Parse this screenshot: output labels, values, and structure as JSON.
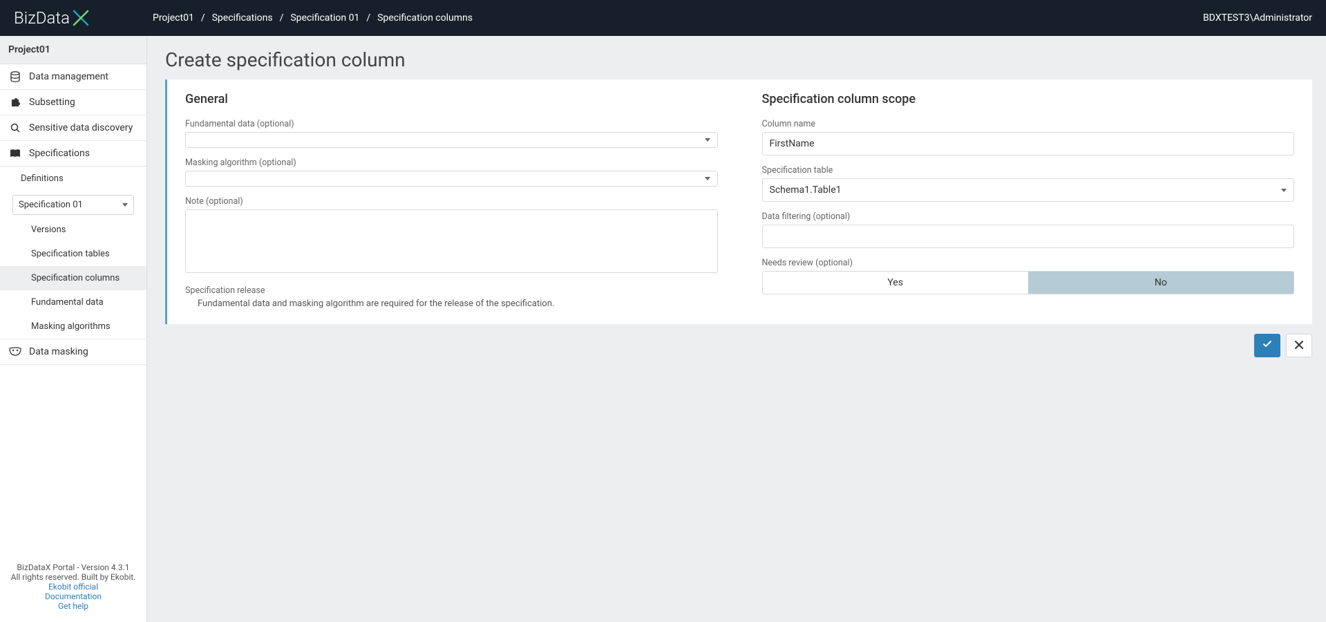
{
  "header": {
    "logo_text": "BizData",
    "breadcrumbs": [
      "Project01",
      "Specifications",
      "Specification 01",
      "Specification columns"
    ],
    "user": "BDXTEST3\\Administrator"
  },
  "sidebar": {
    "project": "Project01",
    "items": [
      {
        "label": "Data management",
        "icon": "database"
      },
      {
        "label": "Subsetting",
        "icon": "puzzle"
      },
      {
        "label": "Sensitive data discovery",
        "icon": "search"
      },
      {
        "label": "Specifications",
        "icon": "book"
      }
    ],
    "definitions_label": "Definitions",
    "spec_select": "Specification 01",
    "subitems": [
      {
        "label": "Versions"
      },
      {
        "label": "Specification tables"
      },
      {
        "label": "Specification columns",
        "active": true
      },
      {
        "label": "Fundamental data"
      },
      {
        "label": "Masking algorithms"
      }
    ],
    "data_masking": {
      "label": "Data masking",
      "icon": "mask"
    },
    "footer": {
      "line1": "BizDataX Portal - Version 4.3.1",
      "line2": "All rights reserved. Built by Ekobit.",
      "links": [
        "Ekobit official",
        "Documentation",
        "Get help"
      ]
    }
  },
  "page": {
    "title": "Create specification column",
    "general": {
      "title": "General",
      "fundamental_label": "Fundamental data (optional)",
      "fundamental_value": "",
      "masking_label": "Masking algorithm (optional)",
      "masking_value": "",
      "note_label": "Note (optional)",
      "note_value": "",
      "release_label": "Specification release",
      "release_note": "Fundamental data and masking algorithm are required for the release of the specification."
    },
    "scope": {
      "title": "Specification column scope",
      "column_label": "Column name",
      "column_value": "FirstName",
      "table_label": "Specification table",
      "table_value": "Schema1.Table1",
      "filter_label": "Data filtering (optional)",
      "filter_value": "",
      "review_label": "Needs review (optional)",
      "yes": "Yes",
      "no": "No"
    }
  }
}
